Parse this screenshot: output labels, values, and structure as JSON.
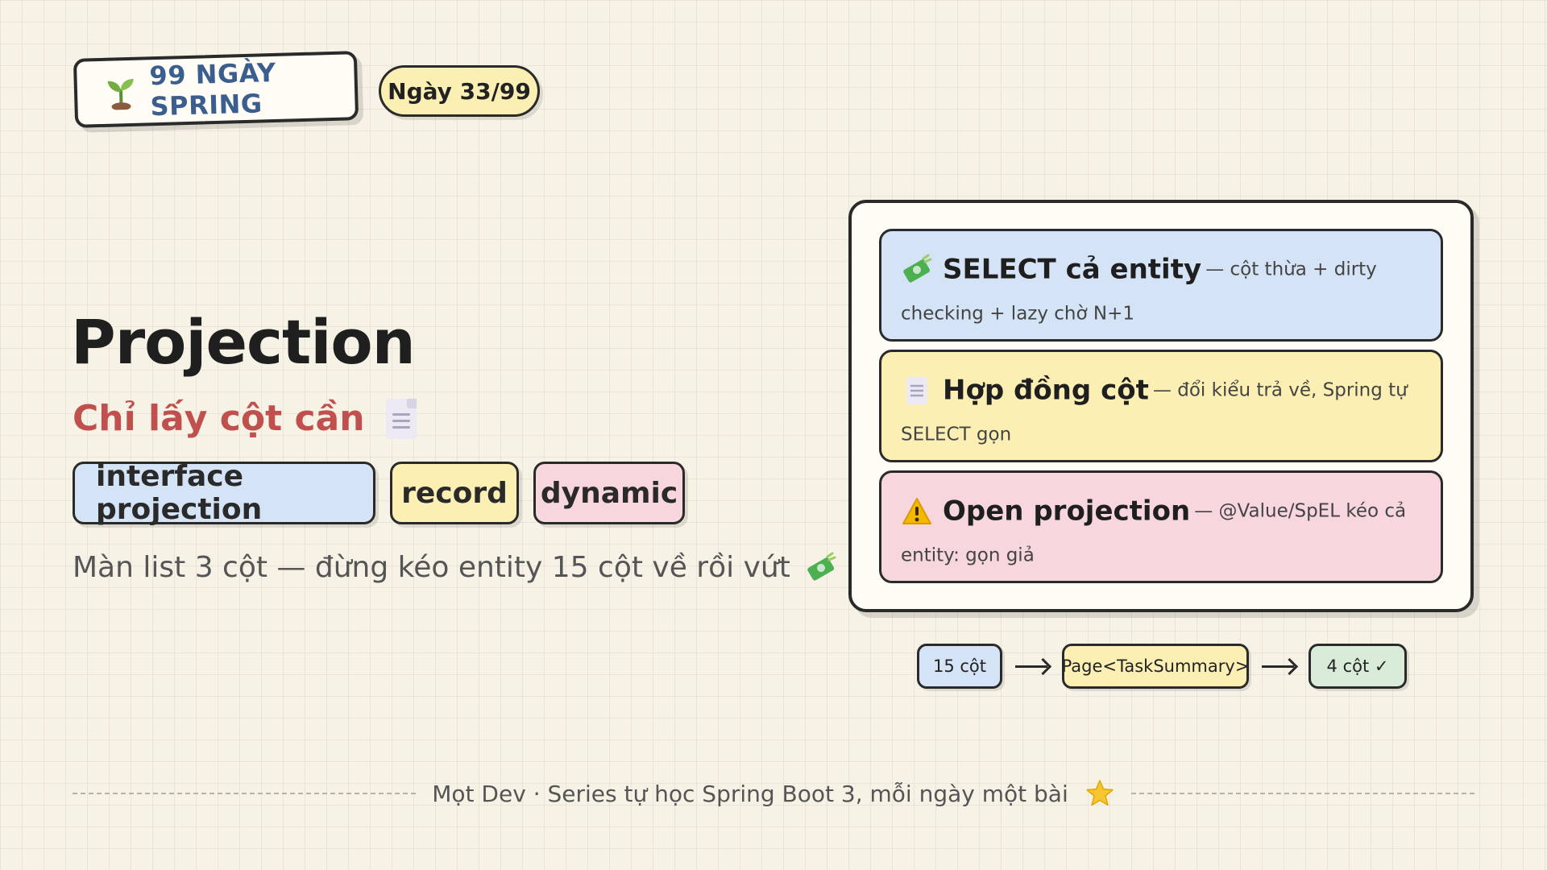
{
  "header": {
    "brand": "99 NGÀY SPRING",
    "brand_icon": "sprout-icon",
    "day": "Ngày 33/99"
  },
  "main": {
    "title": "Projection",
    "subtitle": "Chỉ lấy cột cần",
    "subtitle_icon": "document-icon",
    "tags": [
      "interface projection",
      "record",
      "dynamic"
    ],
    "tagline": "Màn list 3 cột — đừng kéo entity 15 cột về rồi vứt",
    "tagline_icon": "money-icon"
  },
  "panel": {
    "cards": [
      {
        "icon": "money-icon",
        "head": "SELECT cả entity",
        "desc": "— cột thừa + dirty checking + lazy chờ N+1",
        "color": "#d4e3f6"
      },
      {
        "icon": "document-icon",
        "head": "Hợp đồng cột",
        "desc": "— đổi kiểu trả về, Spring tự SELECT gọn",
        "color": "#fcefb4"
      },
      {
        "icon": "warning-icon",
        "head": "Open projection",
        "desc": "— @Value/SpEL kéo cả entity: gọn giả",
        "color": "#f7d6dd"
      }
    ]
  },
  "flow": {
    "steps": [
      "15 cột",
      "Page<TaskSummary>",
      "4 cột ✓"
    ]
  },
  "footer": {
    "text": "Mọt Dev · Series tự học Spring Boot 3, mỗi ngày một bài",
    "icon": "star-icon"
  }
}
